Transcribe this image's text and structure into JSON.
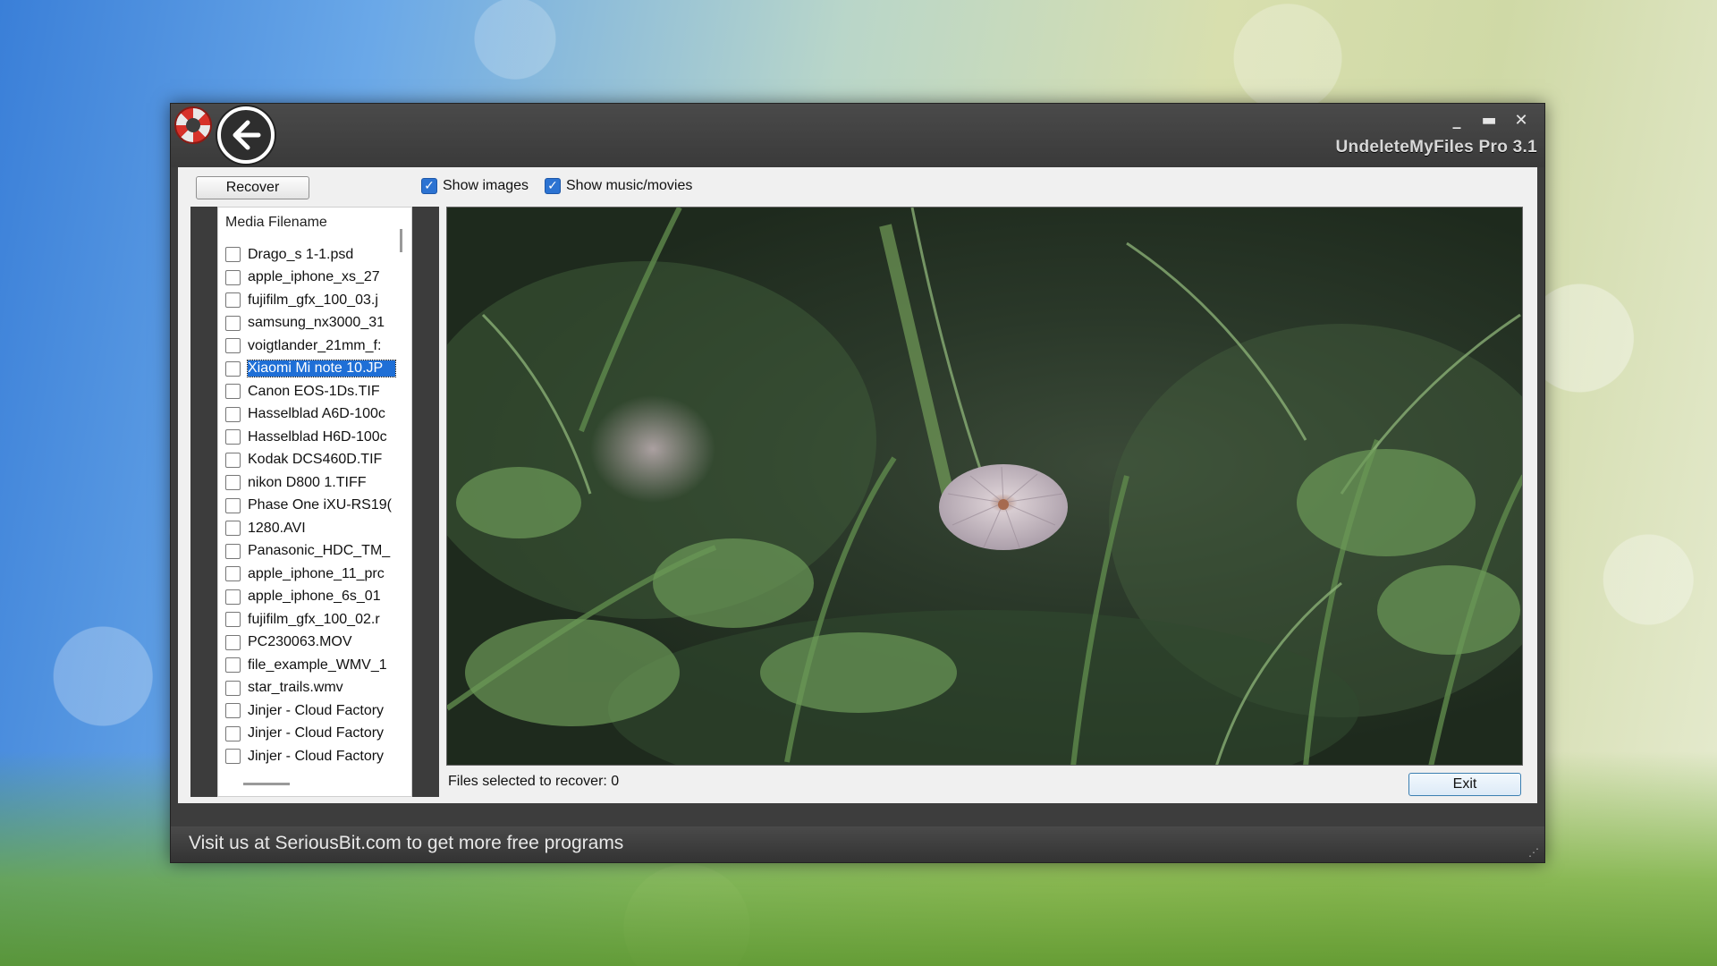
{
  "window": {
    "title": "UndeleteMyFiles Pro 3.1",
    "controls": {
      "minimize": "_",
      "maximize": "▬",
      "close": "✕"
    }
  },
  "toolbar": {
    "recover_label": "Recover",
    "show_images_label": "Show images",
    "show_images_checked": true,
    "show_music_label": "Show music/movies",
    "show_music_checked": true
  },
  "file_list": {
    "header": "Media Filename",
    "items": [
      "Drago_s 1-1.psd",
      "apple_iphone_xs_27",
      "fujifilm_gfx_100_03.j",
      "samsung_nx3000_31",
      "voigtlander_21mm_f:",
      "Xiaomi Mi note 10.JP",
      "Canon EOS-1Ds.TIF",
      "Hasselblad A6D-100c",
      "Hasselblad H6D-100c",
      "Kodak DCS460D.TIF",
      "nikon D800 1.TIFF",
      "Phase One iXU-RS19(",
      "1280.AVI",
      "Panasonic_HDC_TM_",
      "apple_iphone_11_prc",
      "apple_iphone_6s_01",
      "fujifilm_gfx_100_02.r",
      "PC230063.MOV",
      "file_example_WMV_1",
      "star_trails.wmv",
      "Jinjer - Cloud Factory",
      "Jinjer - Cloud Factory",
      "Jinjer - Cloud Factory"
    ],
    "selected_index": 5
  },
  "status": {
    "files_selected": "Files selected to recover: 0"
  },
  "exit_label": "Exit",
  "footer": {
    "text": "Visit us at SeriousBit.com to get more free programs"
  },
  "colors": {
    "accent": "#1f6fd6",
    "chrome": "#3d3d3d"
  }
}
